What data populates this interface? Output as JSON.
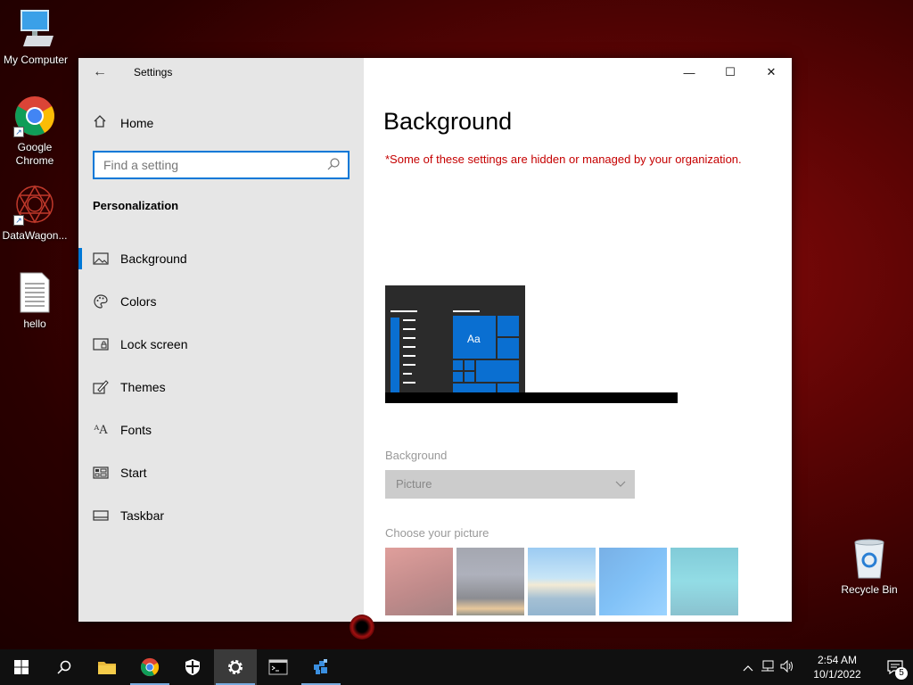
{
  "desktop": {
    "icons": [
      {
        "label": "My Computer"
      },
      {
        "label": "Google Chrome"
      },
      {
        "label": "DataWagon..."
      },
      {
        "label": "hello"
      },
      {
        "label": "Recycle Bin"
      }
    ]
  },
  "window": {
    "title": "Settings",
    "controls": {
      "minimize": "—",
      "maximize": "☐",
      "close": "✕"
    }
  },
  "nav": {
    "home_label": "Home",
    "search_placeholder": "Find a setting",
    "section_title": "Personalization",
    "items": [
      {
        "label": "Background",
        "icon": "picture-icon",
        "active": true
      },
      {
        "label": "Colors",
        "icon": "palette-icon"
      },
      {
        "label": "Lock screen",
        "icon": "lock-screen-icon"
      },
      {
        "label": "Themes",
        "icon": "brush-icon"
      },
      {
        "label": "Fonts",
        "icon": "font-icon"
      },
      {
        "label": "Start",
        "icon": "start-icon"
      },
      {
        "label": "Taskbar",
        "icon": "taskbar-icon"
      }
    ]
  },
  "content": {
    "heading": "Background",
    "managed_notice": "*Some of these settings are hidden or managed by your organization.",
    "preview_tile_text": "Aa",
    "background_label": "Background",
    "background_value": "Picture",
    "choose_picture_label": "Choose your picture"
  },
  "taskbar": {
    "clock_time": "2:54 AM",
    "clock_date": "10/1/2022",
    "notification_count": "5"
  },
  "colors": {
    "accent": "#0078d7",
    "warning": "#c50000"
  }
}
